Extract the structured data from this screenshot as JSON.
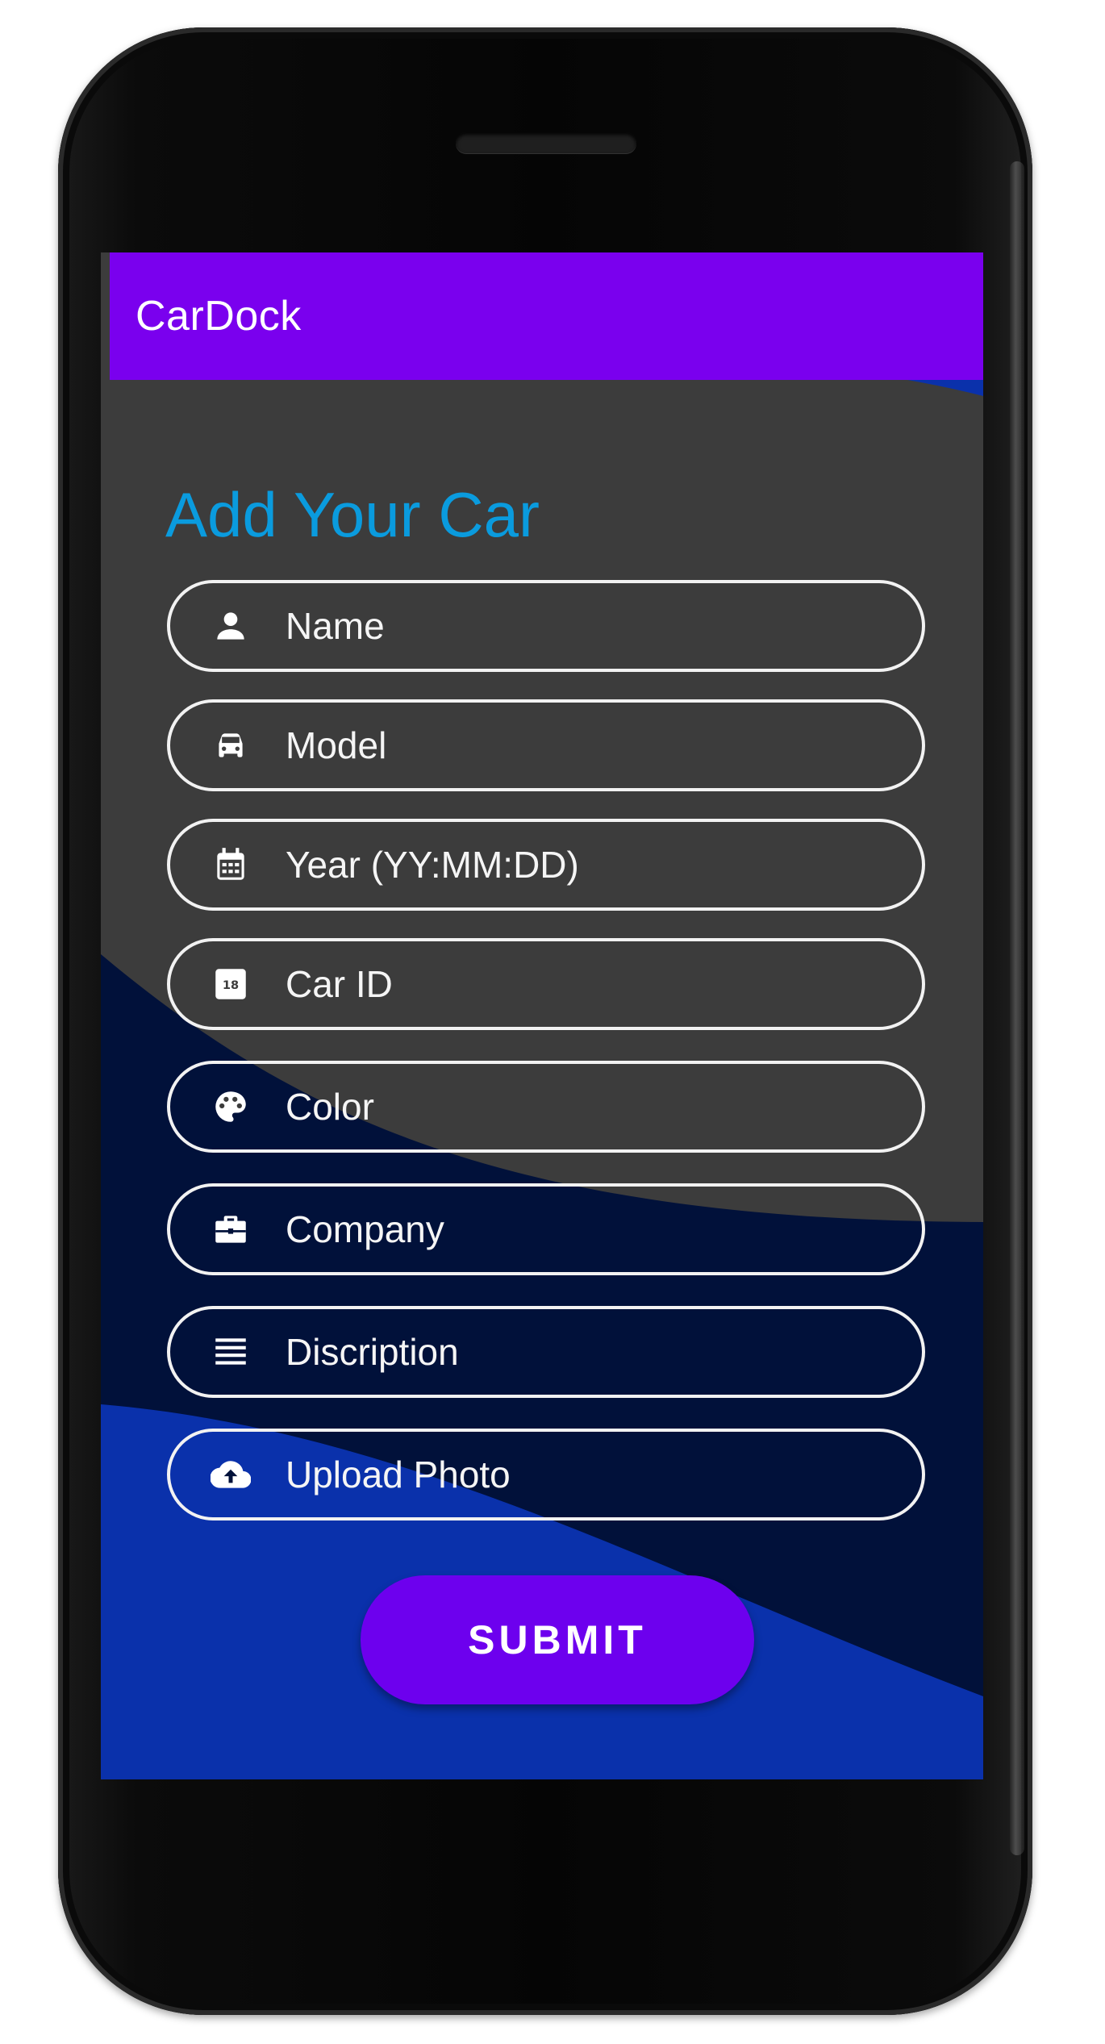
{
  "app": {
    "title": "CarDock"
  },
  "form": {
    "title": "Add Your Car",
    "fields": [
      {
        "label": "Name",
        "icon": "person-icon"
      },
      {
        "label": "Model",
        "icon": "car-icon"
      },
      {
        "label": "Year (YY:MM:DD)",
        "icon": "calendar-icon"
      },
      {
        "label": "Car ID",
        "icon": "date-badge-icon"
      },
      {
        "label": "Color",
        "icon": "palette-icon"
      },
      {
        "label": "Company",
        "icon": "briefcase-icon"
      },
      {
        "label": "Discription",
        "icon": "list-lines-icon"
      },
      {
        "label": "Upload Photo",
        "icon": "cloud-upload-icon"
      }
    ],
    "submit_label": "SUBMIT",
    "badge_text": "18"
  },
  "colors": {
    "appbar": "#7a00ee",
    "title": "#0a9bde",
    "submit": "#6d00ee",
    "background_gray": "#3c3c3c",
    "background_navy": "#01113a",
    "background_blue": "#0a31ab"
  }
}
